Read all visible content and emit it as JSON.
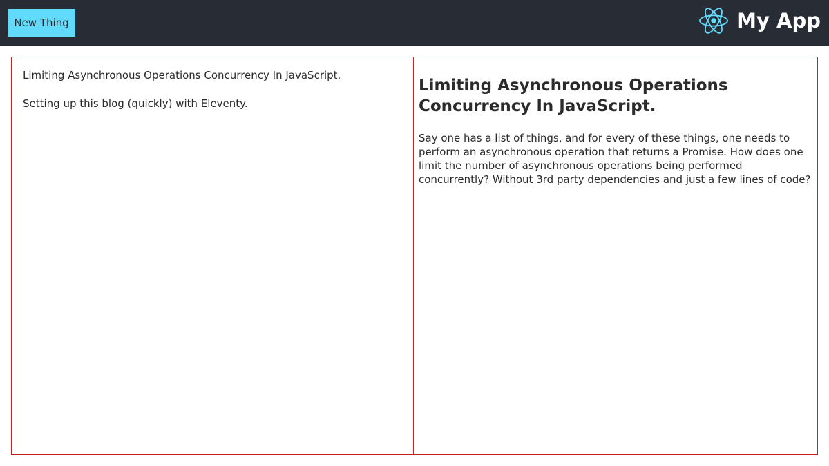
{
  "header": {
    "new_button_label": "New Thing",
    "app_title": "My App",
    "logo_icon": "react-atom-icon",
    "background_color": "#282c34",
    "accent_color": "#61dafb"
  },
  "sidebar": {
    "posts": [
      {
        "title": "Limiting Asynchronous Operations Concurrency In JavaScript."
      },
      {
        "title": "Setting up this blog (quickly) with Eleventy."
      }
    ]
  },
  "article": {
    "title": "Limiting Asynchronous Operations Concurrency In JavaScript.",
    "body": "Say one has a list of things, and for every of these things, one needs to perform an asynchronous operation that returns a Promise. How does one limit the number of asynchronous operations being performed concurrently? Without 3rd party dependencies and just a few lines of code?"
  },
  "theme": {
    "border_color": "#cc1f1f"
  }
}
